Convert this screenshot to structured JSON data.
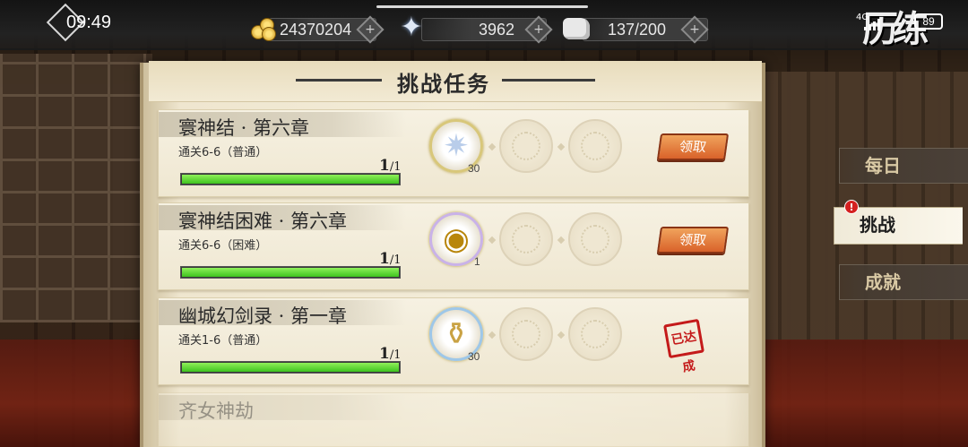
{
  "status_bar": {
    "time": "09:49",
    "network": "4G",
    "battery": "89"
  },
  "resources": {
    "coins": "24370204",
    "stars": "3962",
    "stamina": "137/200"
  },
  "header_deco": "历练",
  "panel": {
    "title": "挑战任务"
  },
  "tasks": [
    {
      "name": "寰神结 · 第六章",
      "desc": "通关6-6（普通）",
      "progress_current": "1",
      "progress_total": "/1",
      "progress_fraction": 1,
      "reward_count": "30",
      "reward_icon": "star-crystal-icon",
      "action_label": "领取",
      "claimed": false
    },
    {
      "name": "寰神结困难 · 第六章",
      "desc": "通关6-6（困难）",
      "progress_current": "1",
      "progress_total": "/1",
      "progress_fraction": 1,
      "reward_count": "1",
      "reward_icon": "gold-coin-icon",
      "action_label": "领取",
      "claimed": false
    },
    {
      "name": "幽城幻剑录 · 第一章",
      "desc": "通关1-6（普通）",
      "progress_current": "1",
      "progress_total": "/1",
      "progress_fraction": 1,
      "reward_count": "30",
      "reward_icon": "potion-flask-icon",
      "action_label": "已达成",
      "claimed": true
    },
    {
      "name": "齐女神劫",
      "desc": "",
      "partial": true
    }
  ],
  "side_tabs": [
    {
      "label": "每日",
      "active": false
    },
    {
      "label": "挑战",
      "active": true,
      "badge": "!"
    },
    {
      "label": "成就",
      "active": false
    }
  ],
  "colors": {
    "progress": "#3fc41f",
    "claim_button": "#d9622a",
    "stamp": "#c41a1a",
    "parchment": "#f3ecd8"
  }
}
